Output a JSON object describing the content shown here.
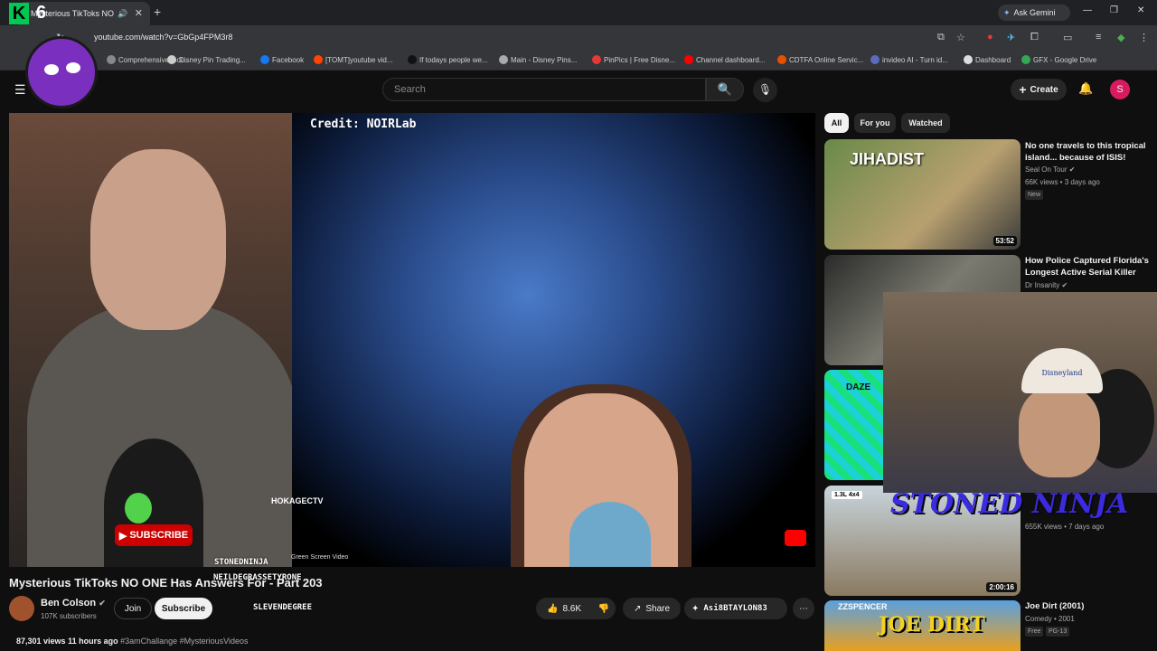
{
  "browser": {
    "tab_title": "Mysterious TikToks NO ONE",
    "tab_audio": "🔊",
    "tab_close": "✕",
    "new_tab": "+",
    "gemini_label": "Ask Gemini",
    "win_min": "—",
    "win_max": "❐",
    "win_close": "✕",
    "url": "youtube.com/watch?v=GbGp4FPM3r8"
  },
  "bookmarks": [
    {
      "label": "Comprehensive Gol...",
      "color": "#888888"
    },
    {
      "label": "Disney Pin Trading...",
      "color": "#cccccc"
    },
    {
      "label": "Facebook",
      "color": "#1877f2"
    },
    {
      "label": "[TOMT]youtube vid...",
      "color": "#ff4500"
    },
    {
      "label": "If todays people we...",
      "color": "#111111"
    },
    {
      "label": "Main - Disney Pins...",
      "color": "#aaaaaa"
    },
    {
      "label": "PinPics | Free Disne...",
      "color": "#e53935"
    },
    {
      "label": "Channel dashboard...",
      "color": "#ff0000"
    },
    {
      "label": "CDTFA Online Servic...",
      "color": "#e65100"
    },
    {
      "label": "invideo AI - Turn id...",
      "color": "#5c6bc0"
    },
    {
      "label": "Dashboard",
      "color": "#dddddd"
    },
    {
      "label": "GFX - Google Drive",
      "color": "#34a853"
    }
  ],
  "yt_header": {
    "menu_icon": "☰",
    "search_placeholder": "Search",
    "search_icon": "🔍",
    "mic_icon": "🎙",
    "create_label": "Create",
    "bell_icon": "🔔",
    "avatar_letter": "S"
  },
  "video": {
    "credit_text": "Credit: NOIRLab",
    "hokage_tag": "HOKAGECTV",
    "green_screen_text": "Green Screen Video",
    "subscribe_overlay": "SUBSCRIBE",
    "overlay_names": [
      "STONEDNINJA",
      "NEILDEGRASSETYRONE",
      "SLEVENDEGREE",
      "Asi8BTAYLON83"
    ]
  },
  "video_info": {
    "title": "Mysterious TikToks NO ONE Has Answers For - Part 203",
    "channel_name": "Ben Colson",
    "channel_subs": "107K subscribers",
    "join_label": "Join",
    "subscribe_label": "Subscribe",
    "likes": "8.6K",
    "share_label": "Share",
    "ask_label": "Ask",
    "more_icon": "⋯",
    "views": "87,301 views",
    "posted": "11 hours ago",
    "hashtags": "#3amChallange #MysteriousVideos"
  },
  "chips": [
    "All",
    "For you",
    "Watched"
  ],
  "recommendations": [
    {
      "title": "No one travels to this tropical island... because of ISIS!",
      "channel": "Seal On Tour",
      "meta": "66K views • 3 days ago",
      "badge": "New",
      "duration": "53:52",
      "thumb_text": "JIHADIST"
    },
    {
      "title": "How Police Captured Florida's Longest Active Serial Killer",
      "channel": "Dr Insanity",
      "meta": "",
      "badge": "",
      "duration": "",
      "thumb_text": ""
    },
    {
      "title": "",
      "channel": "",
      "meta": "",
      "badge": "",
      "duration": "",
      "thumb_text": "DAZE"
    },
    {
      "title": "",
      "channel": "",
      "meta": "655K views • 7 days ago",
      "badge": "",
      "duration": "2:00:16",
      "thumb_text": "1.3L 4x4"
    },
    {
      "title": "Joe Dirt (2001)",
      "channel": "Comedy • 2001",
      "meta": "",
      "badge": "Free",
      "badge2": "PG-13",
      "duration": "",
      "thumb_text": "JOE DIRT"
    }
  ],
  "overlay": {
    "k6_letter": "K",
    "k6_num": "6",
    "cam_hat_text": "Disneyland",
    "stoned_ninja": "STONED NINJA",
    "zzspencer": "ZZSPENCER"
  },
  "colors": {
    "bg": "#0f0f0f",
    "accent_red": "#ff0000",
    "subscribe_bg": "#f1f1f1"
  }
}
